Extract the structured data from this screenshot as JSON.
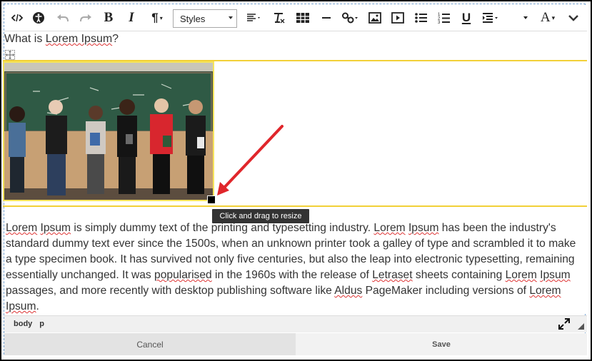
{
  "toolbar": {
    "styles_label": "Styles",
    "icons": [
      "source-code-icon",
      "accessibility-icon",
      "undo-icon",
      "redo-icon",
      "bold-icon",
      "italic-icon",
      "paragraph-icon",
      "align-icon",
      "clear-format-icon",
      "table-icon",
      "horizontal-line-icon",
      "link-icon",
      "image-icon",
      "media-icon",
      "bulleted-list-icon",
      "numbered-list-icon",
      "underline-icon",
      "indent-icon",
      "dropdown-icon",
      "font-color-icon",
      "chevron-down-icon"
    ]
  },
  "editor": {
    "heading_before": "What is ",
    "heading_underlined": "Lorem Ipsum",
    "heading_after": "?",
    "tooltip": "Click and drag to resize",
    "paragraph": "Lorem Ipsum is simply dummy text of the printing and typesetting industry. Lorem Ipsum has been the industry's standard dummy text ever since the 1500s, when an unknown printer took a galley of type and scrambled it to make a type specimen book. It has survived not only five centuries, but also the leap into electronic typesetting, remaining essentially unchanged. It was popularised in the 1960s with the release of Letraset sheets containing Lorem Ipsum passages, and more recently with desktop publishing software like Aldus PageMaker including versions of Lorem Ipsum."
  },
  "statusbar": {
    "path": [
      "body",
      "p"
    ]
  },
  "buttons": {
    "cancel": "Cancel",
    "save": "Save"
  },
  "colors": {
    "selection_border": "#f2d038",
    "annotation_arrow": "#e0262b",
    "spellcheck_underline": "#dd3333"
  }
}
